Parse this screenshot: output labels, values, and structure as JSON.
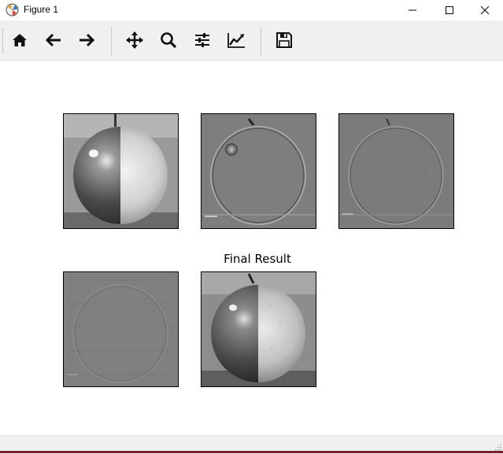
{
  "window": {
    "title": "Figure 1",
    "minimize_icon": "minimize-icon",
    "maximize_icon": "maximize-icon",
    "close_icon": "close-icon"
  },
  "toolbar": {
    "buttons": [
      {
        "name": "home",
        "icon": "home-icon"
      },
      {
        "name": "back",
        "icon": "arrow-left-icon"
      },
      {
        "name": "forward",
        "icon": "arrow-right-icon"
      },
      {
        "name": "pan",
        "icon": "move-icon"
      },
      {
        "name": "zoom",
        "icon": "search-icon"
      },
      {
        "name": "configure-subplots",
        "icon": "sliders-icon"
      },
      {
        "name": "edit-axes",
        "icon": "line-chart-icon"
      },
      {
        "name": "save",
        "icon": "save-icon"
      }
    ]
  },
  "figure": {
    "subplots": [
      {
        "row": 1,
        "col": 1,
        "title": "",
        "content": "blended apple image (smooth)"
      },
      {
        "row": 1,
        "col": 2,
        "title": "",
        "content": "laplacian level (edge detail)"
      },
      {
        "row": 1,
        "col": 3,
        "title": "",
        "content": "laplacian level (fine detail)"
      },
      {
        "row": 2,
        "col": 1,
        "title": "",
        "content": "laplacian level (finest detail)"
      },
      {
        "row": 2,
        "col": 2,
        "title": "Final Result",
        "content": "blended apple image"
      }
    ]
  },
  "colors": {
    "titlebar_bg": "#ffffff",
    "toolbar_bg": "#f0f0f0",
    "canvas_bg": "#ffffff",
    "bottom_border": "#7a1f2b"
  }
}
